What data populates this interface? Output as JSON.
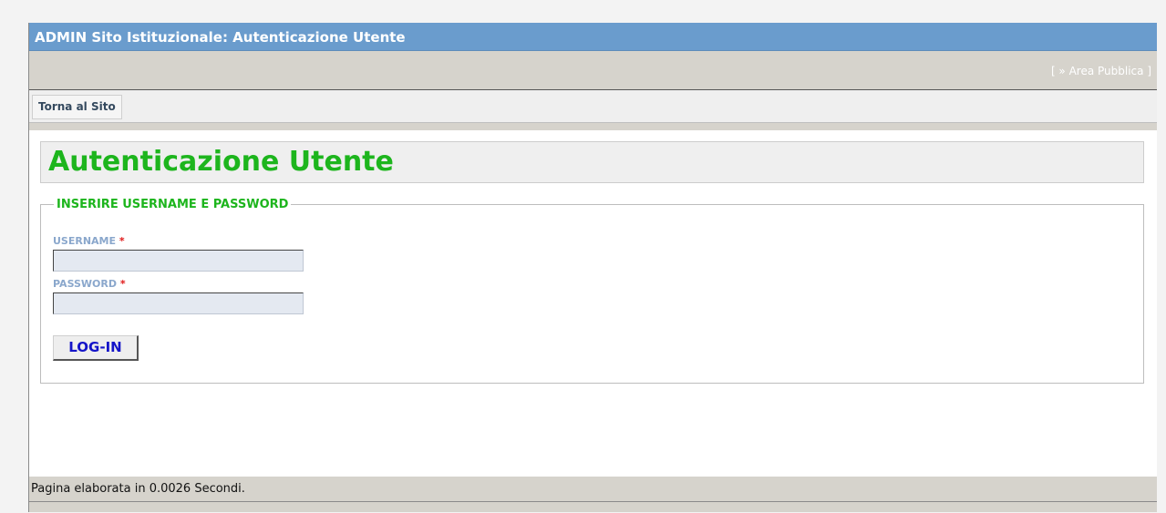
{
  "header": {
    "title": "ADMIN Sito Istituzionale: Autenticazione Utente"
  },
  "top_links": {
    "area_pubblica": "[ » Area Pubblica ]"
  },
  "nav": {
    "back_label": "Torna al Sito"
  },
  "main": {
    "title": "Autenticazione Utente",
    "form": {
      "legend": "INSERIRE USERNAME E PASSWORD",
      "username_label": "USERNAME",
      "password_label": "PASSWORD",
      "required_mark": "*",
      "username_value": "",
      "password_value": "",
      "submit_label": "LOG-IN"
    }
  },
  "footer": {
    "text": "Pagina elaborata in 0.0026 Secondi."
  },
  "colors": {
    "titlebar": "#6a9ccd",
    "heading_green": "#1db51d",
    "label_blue": "#8aa7cc",
    "button_text": "#1414c8",
    "required_red": "#e01818"
  }
}
